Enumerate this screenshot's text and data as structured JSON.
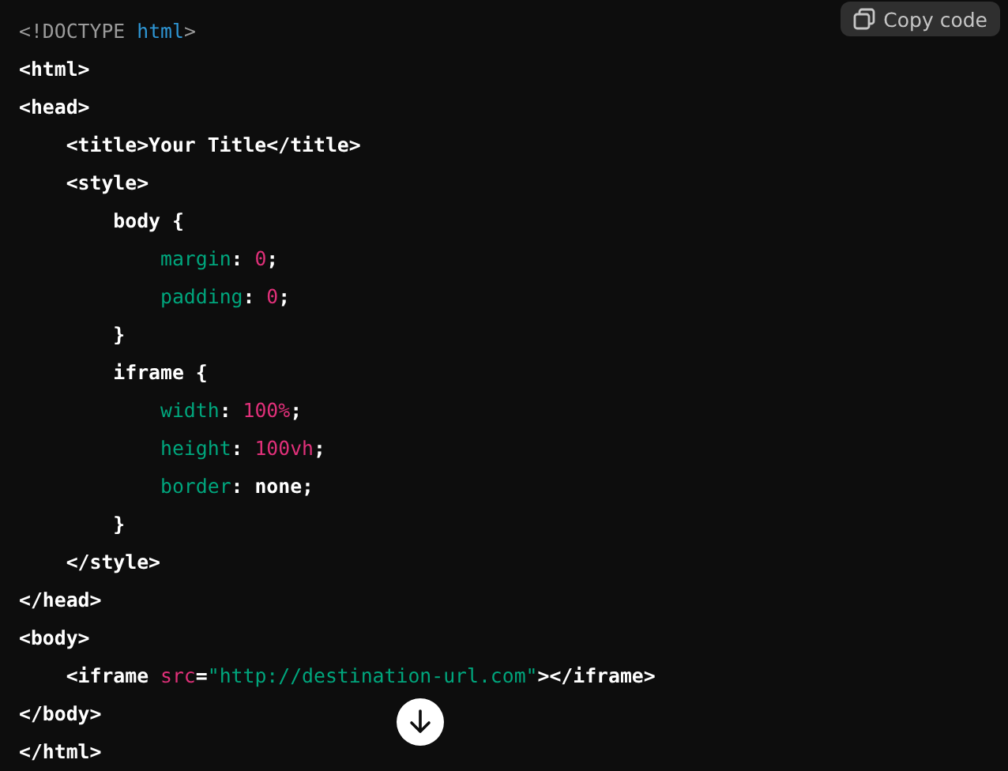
{
  "copy_button": {
    "label": "Copy code"
  },
  "code_lines": [
    {
      "tokens": [
        {
          "kind": "doctype",
          "text": "<!DOCTYPE "
        },
        {
          "kind": "keyword",
          "text": "html"
        },
        {
          "kind": "doctype",
          "text": ">"
        }
      ]
    },
    {
      "tokens": [
        {
          "kind": "plain",
          "text": "<html>"
        }
      ]
    },
    {
      "tokens": [
        {
          "kind": "plain",
          "text": "<head>"
        }
      ],
      "children": [
        {
          "tokens": [
            {
              "kind": "plain",
              "text": "<title>Your Title</title>"
            }
          ]
        },
        {
          "tokens": [
            {
              "kind": "plain",
              "text": "<style>"
            }
          ],
          "children": [
            {
              "tokens": [
                {
                  "kind": "plain",
                  "text": "body {"
                }
              ],
              "children": [
                {
                  "tokens": [
                    {
                      "kind": "property",
                      "text": "margin"
                    },
                    {
                      "kind": "plain",
                      "text": ": "
                    },
                    {
                      "kind": "number",
                      "text": "0"
                    },
                    {
                      "kind": "plain",
                      "text": ";"
                    }
                  ]
                },
                {
                  "tokens": [
                    {
                      "kind": "property",
                      "text": "padding"
                    },
                    {
                      "kind": "plain",
                      "text": ": "
                    },
                    {
                      "kind": "number",
                      "text": "0"
                    },
                    {
                      "kind": "plain",
                      "text": ";"
                    }
                  ]
                }
              ]
            },
            {
              "tokens": [
                {
                  "kind": "plain",
                  "text": "}"
                }
              ]
            },
            {
              "tokens": [
                {
                  "kind": "plain",
                  "text": "iframe {"
                }
              ],
              "children": [
                {
                  "tokens": [
                    {
                      "kind": "property",
                      "text": "width"
                    },
                    {
                      "kind": "plain",
                      "text": ": "
                    },
                    {
                      "kind": "number",
                      "text": "100%"
                    },
                    {
                      "kind": "plain",
                      "text": ";"
                    }
                  ]
                },
                {
                  "tokens": [
                    {
                      "kind": "property",
                      "text": "height"
                    },
                    {
                      "kind": "plain",
                      "text": ": "
                    },
                    {
                      "kind": "number",
                      "text": "100vh"
                    },
                    {
                      "kind": "plain",
                      "text": ";"
                    }
                  ]
                },
                {
                  "tokens": [
                    {
                      "kind": "property",
                      "text": "border"
                    },
                    {
                      "kind": "plain",
                      "text": ": none;"
                    }
                  ]
                }
              ]
            },
            {
              "tokens": [
                {
                  "kind": "plain",
                  "text": "}"
                }
              ]
            }
          ]
        },
        {
          "tokens": [
            {
              "kind": "plain",
              "text": "</style>"
            }
          ]
        }
      ]
    },
    {
      "tokens": [
        {
          "kind": "plain",
          "text": "</head>"
        }
      ]
    },
    {
      "tokens": [
        {
          "kind": "plain",
          "text": "<body>"
        }
      ],
      "children": [
        {
          "tokens": [
            {
              "kind": "plain",
              "text": "<iframe "
            },
            {
              "kind": "attribute",
              "text": "src"
            },
            {
              "kind": "plain",
              "text": "="
            },
            {
              "kind": "string",
              "text": "\"http://destination-url.com\""
            },
            {
              "kind": "plain",
              "text": "></iframe>"
            }
          ]
        }
      ]
    },
    {
      "tokens": [
        {
          "kind": "plain",
          "text": "</body>"
        }
      ]
    },
    {
      "tokens": [
        {
          "kind": "plain",
          "text": "</html>"
        }
      ]
    }
  ]
}
